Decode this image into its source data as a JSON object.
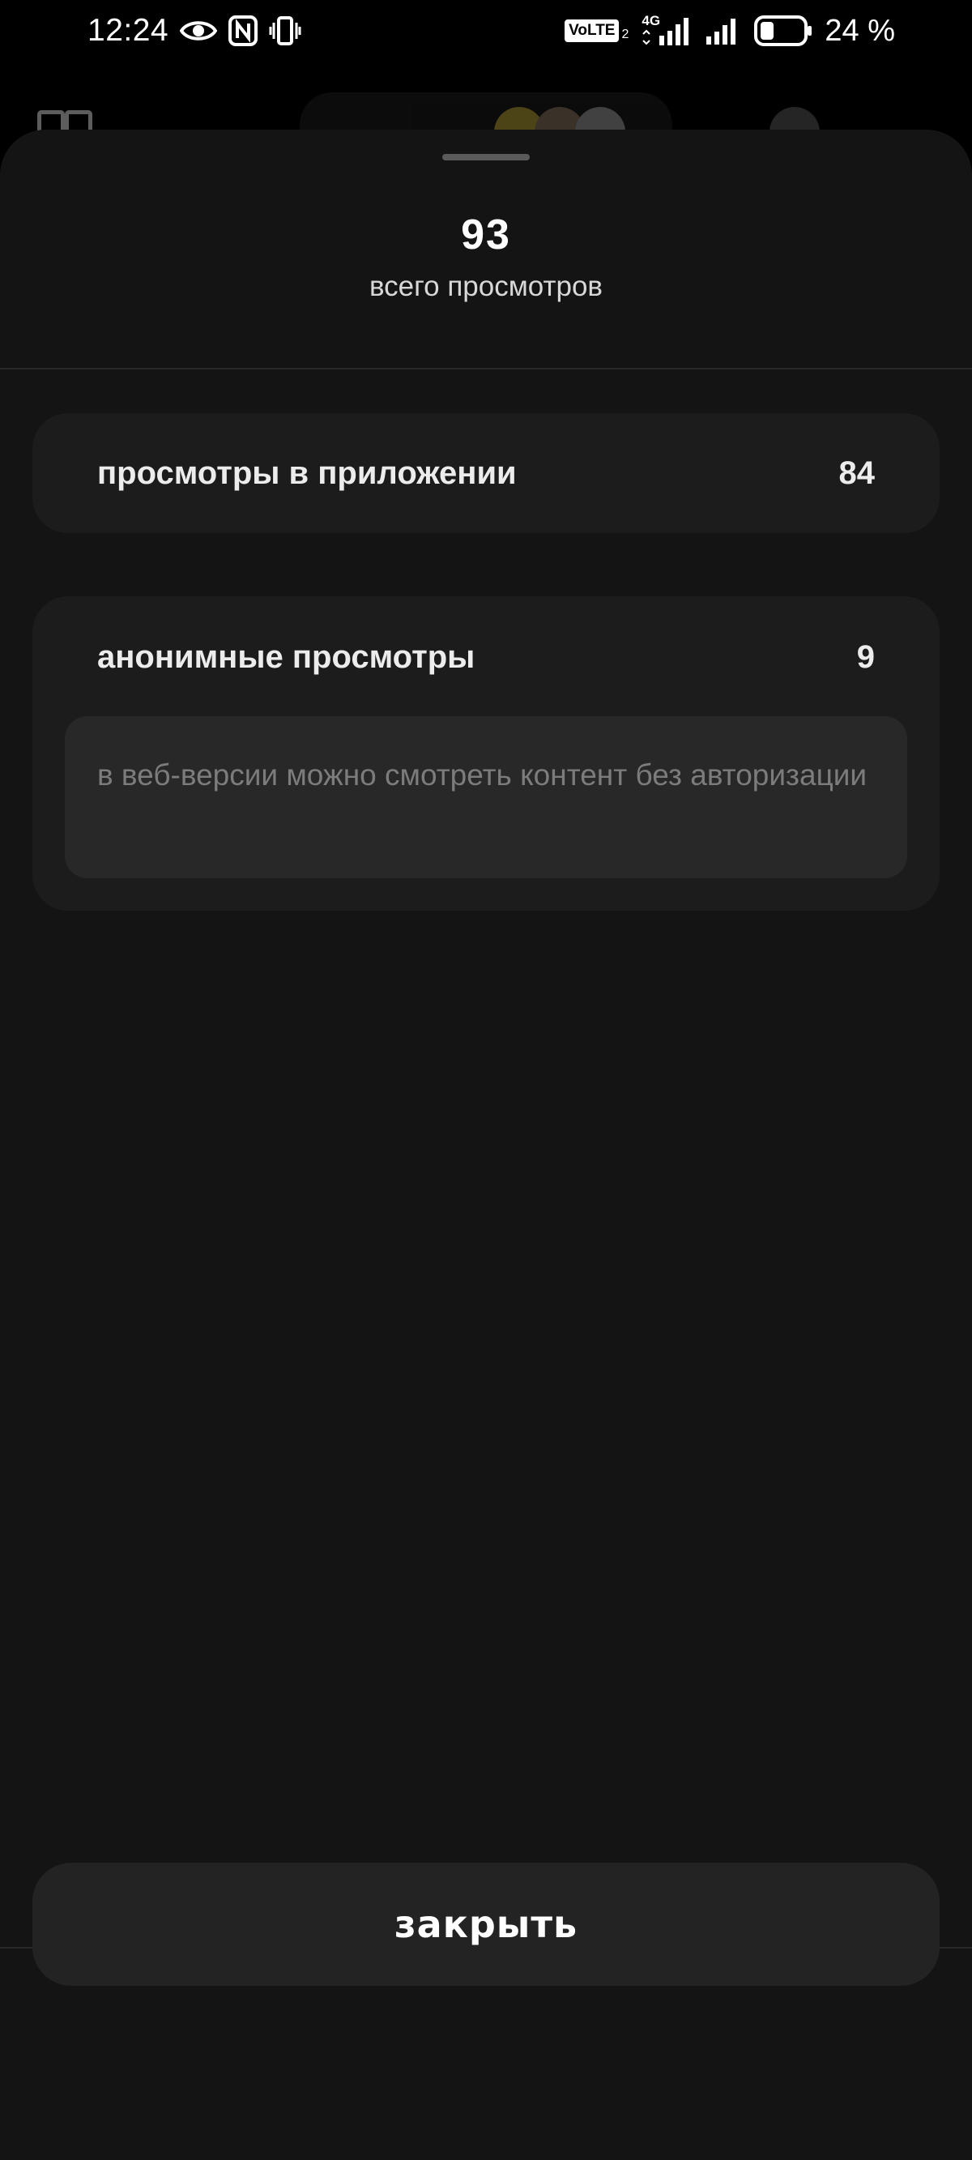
{
  "status_bar": {
    "time": "12:24",
    "battery_percent": "24 %",
    "network_label": "4G",
    "volte_label": "VoLTE",
    "volte_sim": "2",
    "icons": [
      "eye-icon",
      "nfc-icon",
      "vibrate-icon",
      "volte-icon",
      "signal-4g-icon",
      "signal-icon",
      "battery-icon"
    ]
  },
  "sheet": {
    "total_views": "93",
    "total_views_label": "всего просмотров",
    "app_views": {
      "label": "просмотры в приложении",
      "value": "84"
    },
    "anonymous_views": {
      "label": "анонимные просмотры",
      "value": "9",
      "note": "в веб-версии можно смотреть контент без авторизации"
    },
    "close_label": "закрыть"
  },
  "colors": {
    "sheet_bg": "#141414",
    "card_bg": "#1c1c1c",
    "note_bg": "#282828",
    "button_bg": "#232323"
  }
}
